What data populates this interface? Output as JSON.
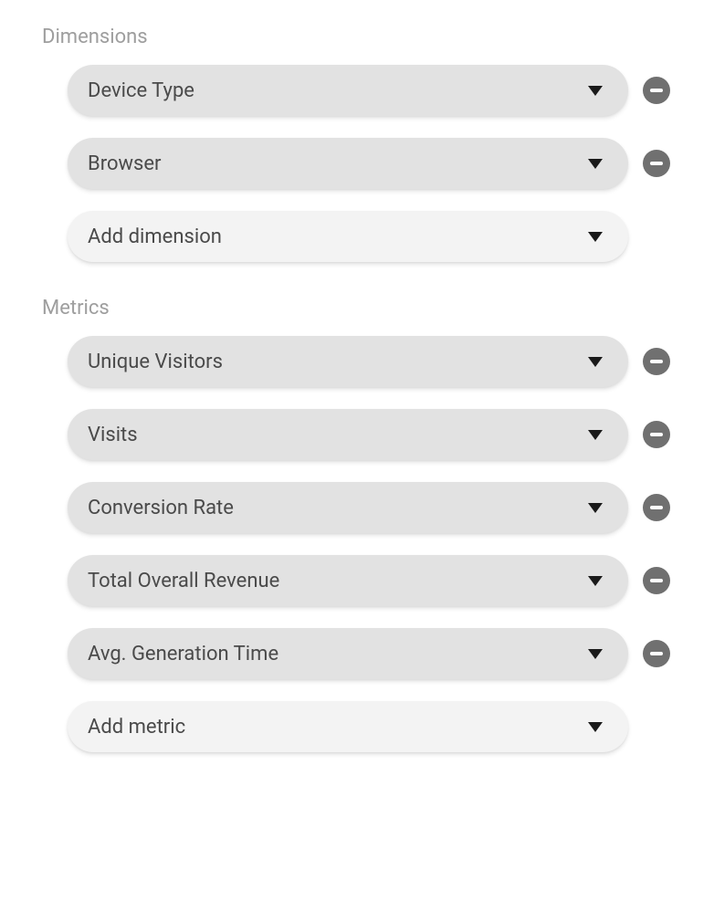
{
  "dimensions": {
    "title": "Dimensions",
    "items": [
      {
        "label": "Device Type"
      },
      {
        "label": "Browser"
      }
    ],
    "add_label": "Add dimension"
  },
  "metrics": {
    "title": "Metrics",
    "items": [
      {
        "label": "Unique Visitors"
      },
      {
        "label": "Visits"
      },
      {
        "label": "Conversion Rate"
      },
      {
        "label": "Total Overall Revenue"
      },
      {
        "label": "Avg. Generation Time"
      }
    ],
    "add_label": "Add metric"
  }
}
